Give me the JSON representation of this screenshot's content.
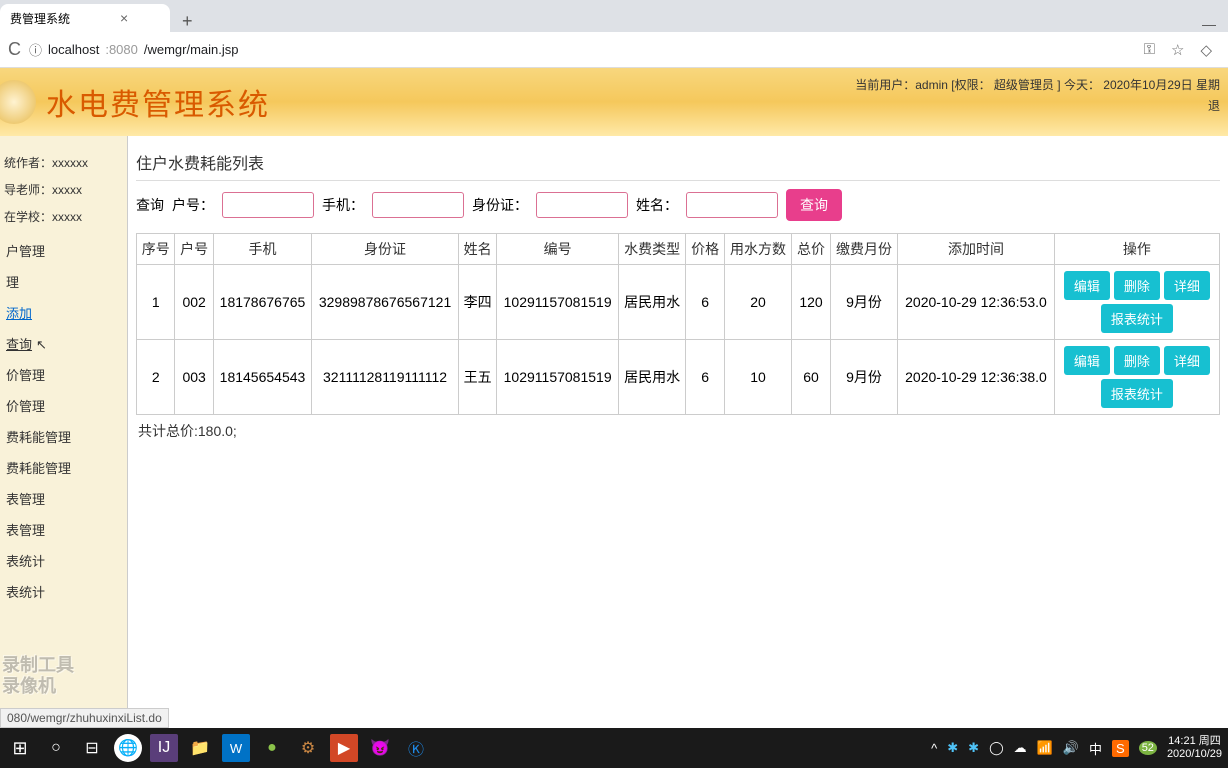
{
  "browser": {
    "tab_title": "费管理系统",
    "url_prefix": "localhost",
    "url_port": ":8080",
    "url_path": "/wemgr/main.jsp",
    "status_url": "080/wemgr/zhuhuxinxiList.do"
  },
  "header": {
    "title": "水电费管理系统",
    "user_line": "当前用户：admin [权限： 超级管理员 ] 今天： 2020年10月29日 星期",
    "logout": "退"
  },
  "sidebar": {
    "info": {
      "author": "统作者：xxxxxx",
      "teacher": "导老师：xxxxx",
      "school": "在学校：xxxxx"
    },
    "items": [
      "户管理",
      "理",
      "添加",
      "查询",
      "价管理",
      "价管理",
      "费耗能管理",
      "费耗能管理",
      "表管理",
      "表管理",
      "表统计",
      "表统计"
    ],
    "watermark1": "录制工具",
    "watermark2": "录像机"
  },
  "main": {
    "title": "住户水费耗能列表",
    "search": {
      "prefix": "查询",
      "account": "户号：",
      "phone": "手机：",
      "idcard": "身份证：",
      "name": "姓名：",
      "button": "查询"
    },
    "table": {
      "headers": [
        "序号",
        "户号",
        "手机",
        "身份证",
        "姓名",
        "编号",
        "水费类型",
        "价格",
        "用水方数",
        "总价",
        "缴费月份",
        "添加时间",
        "操作"
      ],
      "rows": [
        {
          "seq": "1",
          "acct": "002",
          "phone": "18178676765",
          "idcard": "32989878676567121",
          "name": "李四",
          "code": "10291157081519",
          "type": "居民用水",
          "price": "6",
          "qty": "20",
          "total": "120",
          "month": "9月份",
          "time": "2020-10-29 12:36:53.0"
        },
        {
          "seq": "2",
          "acct": "003",
          "phone": "18145654543",
          "idcard": "32111128119111112",
          "name": "王五",
          "code": "10291157081519",
          "type": "居民用水",
          "price": "6",
          "qty": "10",
          "total": "60",
          "month": "9月份",
          "time": "2020-10-29 12:36:38.0"
        }
      ],
      "actions": {
        "edit": "编辑",
        "delete": "删除",
        "detail": "详细",
        "report": "报表统计"
      }
    },
    "total": "共计总价:180.0;"
  },
  "taskbar": {
    "time": "14:21 周四",
    "date": "2020/10/29",
    "badge": "52"
  }
}
